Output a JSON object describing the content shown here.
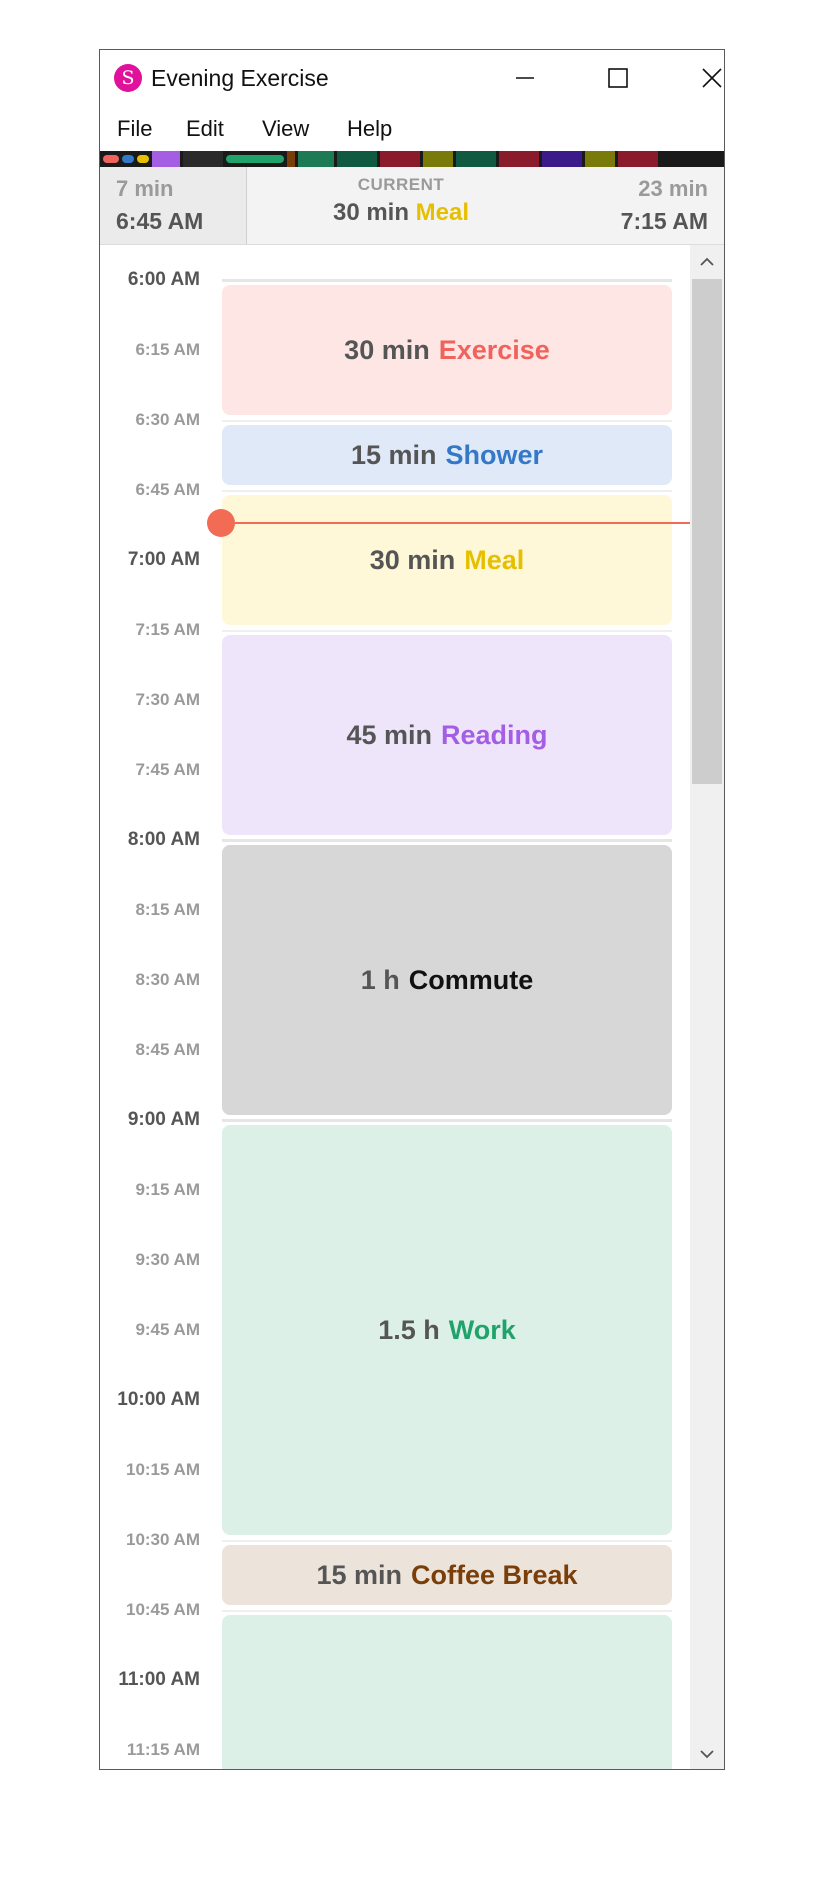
{
  "window": {
    "title": "Evening Exercise",
    "app_icon_letter": "S"
  },
  "menu": {
    "items": [
      "File",
      "Edit",
      "View",
      "Help"
    ]
  },
  "info": {
    "prev_duration": "7 min",
    "prev_time": "6:45 AM",
    "current_label": "CURRENT",
    "current_duration": "30 min",
    "current_activity": "Meal",
    "current_color": "#e6c000",
    "next_duration": "23 min",
    "next_time": "7:15 AM"
  },
  "timeline": {
    "labels": [
      {
        "text": "6:00 AM",
        "major": true
      },
      {
        "text": "6:15 AM",
        "major": false
      },
      {
        "text": "6:30 AM",
        "major": false
      },
      {
        "text": "6:45 AM",
        "major": false
      },
      {
        "text": "7:00 AM",
        "major": true
      },
      {
        "text": "7:15 AM",
        "major": false
      },
      {
        "text": "7:30 AM",
        "major": false
      },
      {
        "text": "7:45 AM",
        "major": false
      },
      {
        "text": "8:00 AM",
        "major": true
      },
      {
        "text": "8:15 AM",
        "major": false
      },
      {
        "text": "8:30 AM",
        "major": false
      },
      {
        "text": "8:45 AM",
        "major": false
      },
      {
        "text": "9:00 AM",
        "major": true
      },
      {
        "text": "9:15 AM",
        "major": false
      },
      {
        "text": "9:30 AM",
        "major": false
      },
      {
        "text": "9:45 AM",
        "major": false
      },
      {
        "text": "10:00 AM",
        "major": true
      },
      {
        "text": "10:15 AM",
        "major": false
      },
      {
        "text": "10:30 AM",
        "major": false
      },
      {
        "text": "10:45 AM",
        "major": false
      },
      {
        "text": "11:00 AM",
        "major": true
      },
      {
        "text": "11:15 AM",
        "major": false
      }
    ],
    "events": [
      {
        "duration": "30 min",
        "name": "Exercise",
        "start_min": 0,
        "length_min": 30,
        "bg": "#fde6e4",
        "color": "#f0635d"
      },
      {
        "duration": "15 min",
        "name": "Shower",
        "start_min": 30,
        "length_min": 15,
        "bg": "#dfe9f7",
        "color": "#3478c8"
      },
      {
        "duration": "30 min",
        "name": "Meal",
        "start_min": 45,
        "length_min": 30,
        "bg": "#fef7d8",
        "color": "#e6c000"
      },
      {
        "duration": "45 min",
        "name": "Reading",
        "start_min": 75,
        "length_min": 45,
        "bg": "#efe5fb",
        "color": "#a35ee4"
      },
      {
        "duration": "1 h",
        "name": "Commute",
        "start_min": 120,
        "length_min": 60,
        "bg": "#d7d7d7",
        "color": "#111111"
      },
      {
        "duration": "1.5 h",
        "name": "Work",
        "start_min": 180,
        "length_min": 90,
        "bg": "#dcf0e7",
        "color": "#20a36a"
      },
      {
        "duration": "15 min",
        "name": "Coffee Break",
        "start_min": 270,
        "length_min": 15,
        "bg": "#ece3da",
        "color": "#7a3e0a"
      },
      {
        "duration": "",
        "name": "",
        "start_min": 285,
        "length_min": 60,
        "bg": "#dcf0e7",
        "color": "#20a36a"
      }
    ],
    "now_min": 52
  },
  "strip_colors": [
    "#f0635d",
    "#3478c8",
    "#e6c000",
    "#a35ee4",
    "#2a2a2a",
    "#20a36a",
    "#1d7a55",
    "#7a3e0a",
    "#0f5a40",
    "#8a1b2a",
    "#7a7a0a",
    "#3b1a8a"
  ]
}
